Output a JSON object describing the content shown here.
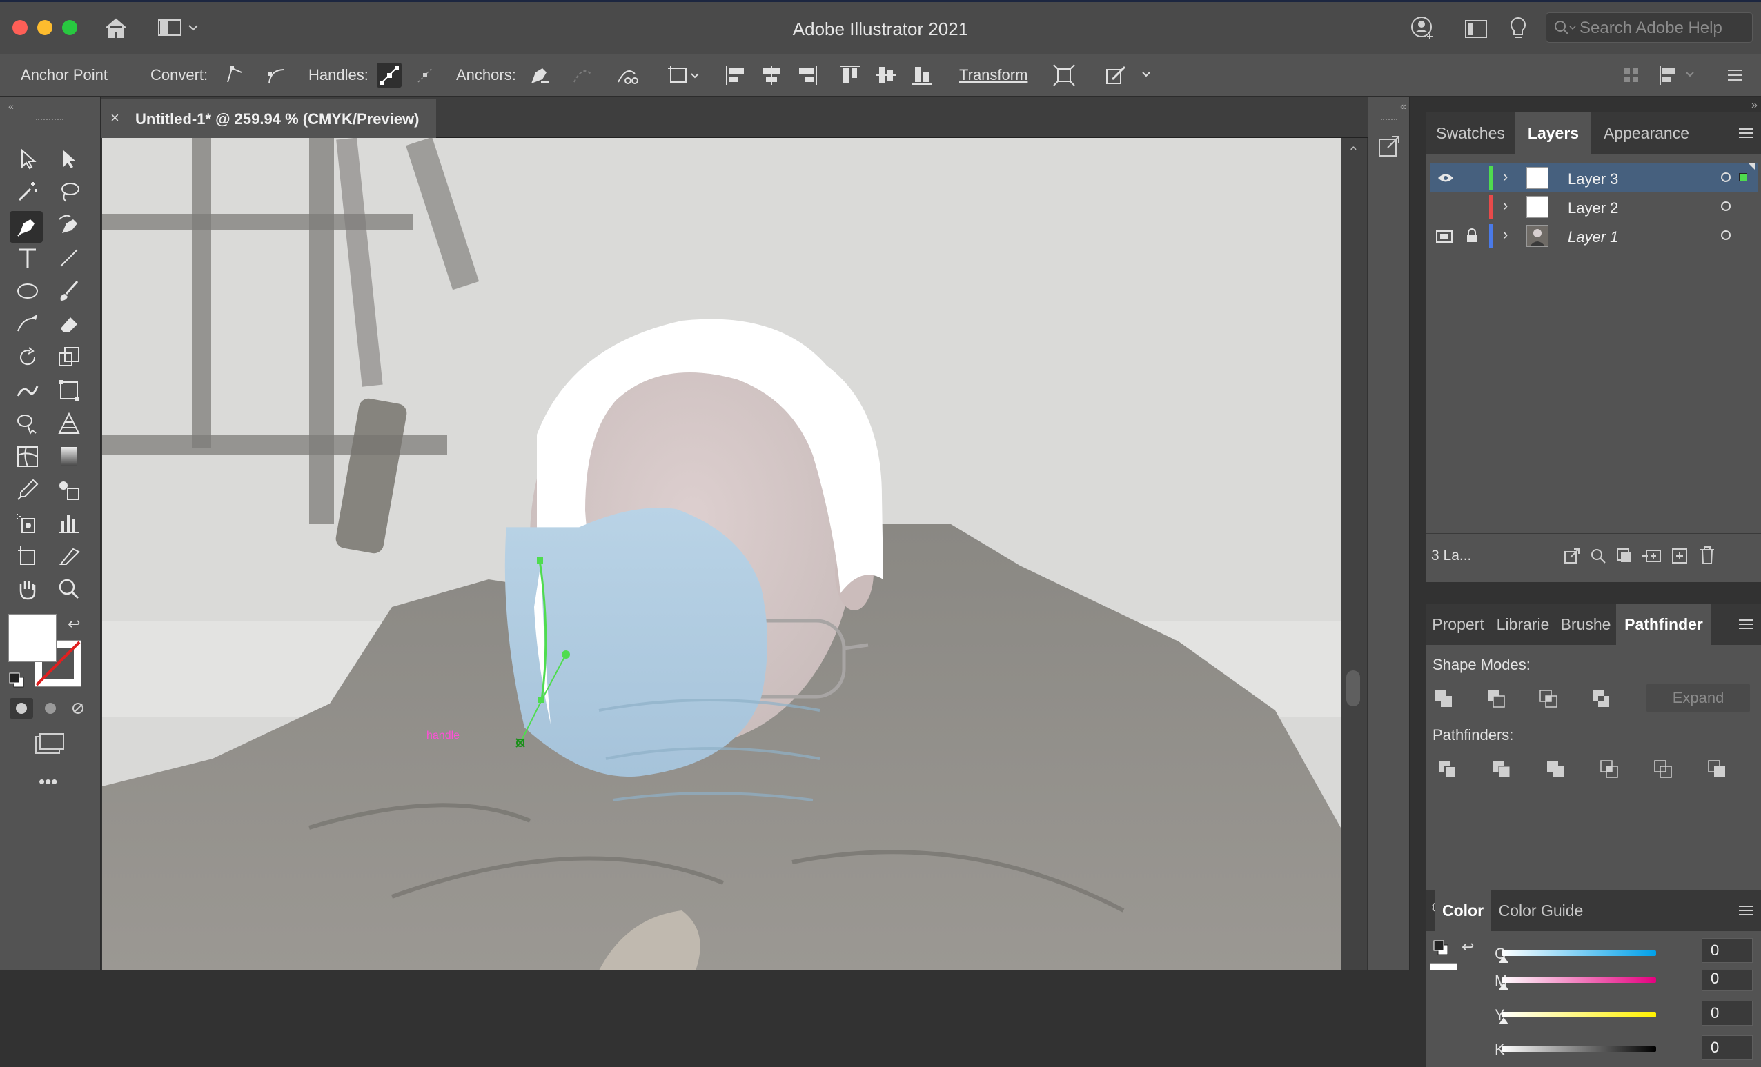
{
  "window": {
    "title": "Adobe Illustrator 2021",
    "search_placeholder": "Search Adobe Help"
  },
  "control_bar": {
    "selection_type": "Anchor Point",
    "convert_label": "Convert:",
    "handles_label": "Handles:",
    "anchors_label": "Anchors:",
    "transform_label": "Transform"
  },
  "document": {
    "tab_title": "Untitled-1* @ 259.94 % (CMYK/Preview)",
    "smart_guide_label": "handle"
  },
  "layers_panel": {
    "tabs": [
      "Swatches",
      "Layers",
      "Appearance"
    ],
    "active_tab": "Layers",
    "layers": [
      {
        "name": "Layer 3",
        "color": "#4fdc4f",
        "selected": true,
        "visible": true,
        "locked": false
      },
      {
        "name": "Layer 2",
        "color": "#e84a4a",
        "selected": false,
        "visible": false,
        "locked": false
      },
      {
        "name": "Layer 1",
        "color": "#4a7ae8",
        "selected": false,
        "visible": true,
        "locked": true
      }
    ],
    "footer_count": "3 La..."
  },
  "pathfinder_panel": {
    "tabs": [
      "Propert",
      "Librarie",
      "Brushe",
      "Pathfinder"
    ],
    "active_tab": "Pathfinder",
    "shape_modes_label": "Shape Modes:",
    "expand_label": "Expand",
    "pathfinders_label": "Pathfinders:"
  },
  "color_panel": {
    "tabs": [
      "Color",
      "Color Guide"
    ],
    "active_tab": "Color",
    "channels": [
      {
        "label": "C",
        "value": "0"
      },
      {
        "label": "M",
        "value": "0"
      },
      {
        "label": "Y",
        "value": "0"
      },
      {
        "label": "K",
        "value": "0"
      }
    ],
    "unit": "%"
  },
  "colors": {
    "ui_bg": "#535353",
    "selection_blue": "#46607e",
    "path_green": "#4fdc4f",
    "guide_magenta": "#ff4fd8"
  }
}
